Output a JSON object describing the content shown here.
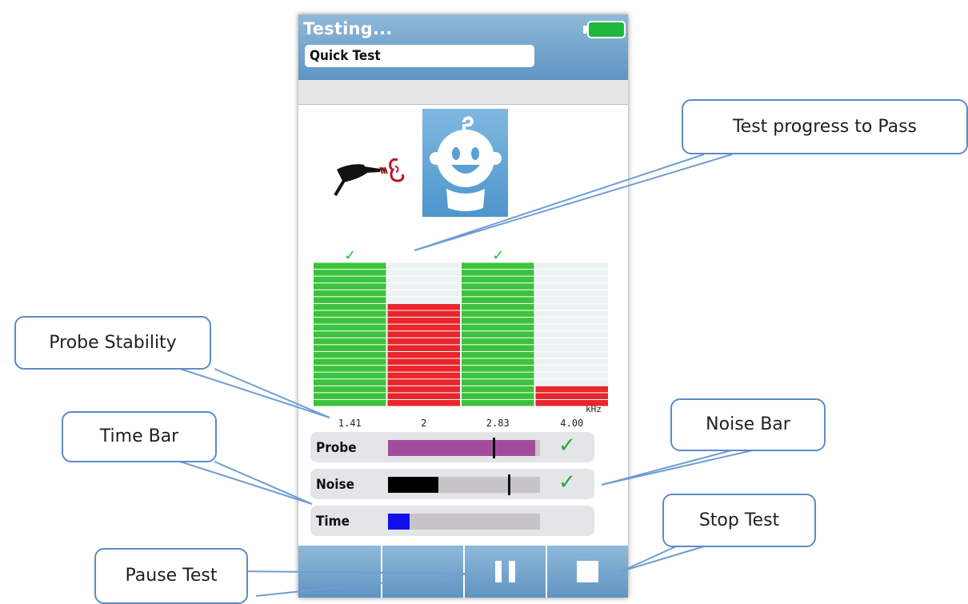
{
  "header": {
    "title": "Testing...",
    "test_name": "Quick Test",
    "battery_color": "#1fb83a"
  },
  "illustration": {
    "probe_icon": "probe-in-ear-icon",
    "baby_icon": "baby-face-icon"
  },
  "chart_data": {
    "type": "bar",
    "xlabel": "kHz",
    "categories": [
      "1.41",
      "2",
      "2.83",
      "4.00"
    ],
    "series": [
      {
        "values": [
          100,
          71,
          100,
          14
        ]
      }
    ],
    "pass": [
      true,
      false,
      true,
      false
    ],
    "colors": {
      "pass": "#3cc23c",
      "fail": "#e8262b",
      "empty": "#edf2f5"
    }
  },
  "measurements": {
    "probe": {
      "label": "Probe",
      "level": 0.97,
      "marker": 0.69,
      "ok": true,
      "color": "#a24d9c"
    },
    "noise": {
      "label": "Noise",
      "level": 0.33,
      "marker": 0.79,
      "ok": true,
      "color": "#000000"
    },
    "time": {
      "label": "Time",
      "level": 0.14,
      "color": "#1010ee"
    }
  },
  "toolbar": {
    "buttons": [
      "empty",
      "empty",
      "pause-icon",
      "stop-icon"
    ]
  },
  "callouts": {
    "progress": "Test progress to Pass",
    "probe_stability": "Probe Stability",
    "time_bar": "Time Bar",
    "noise_bar": "Noise Bar",
    "stop_test": "Stop Test",
    "pause_test": "Pause Test"
  }
}
